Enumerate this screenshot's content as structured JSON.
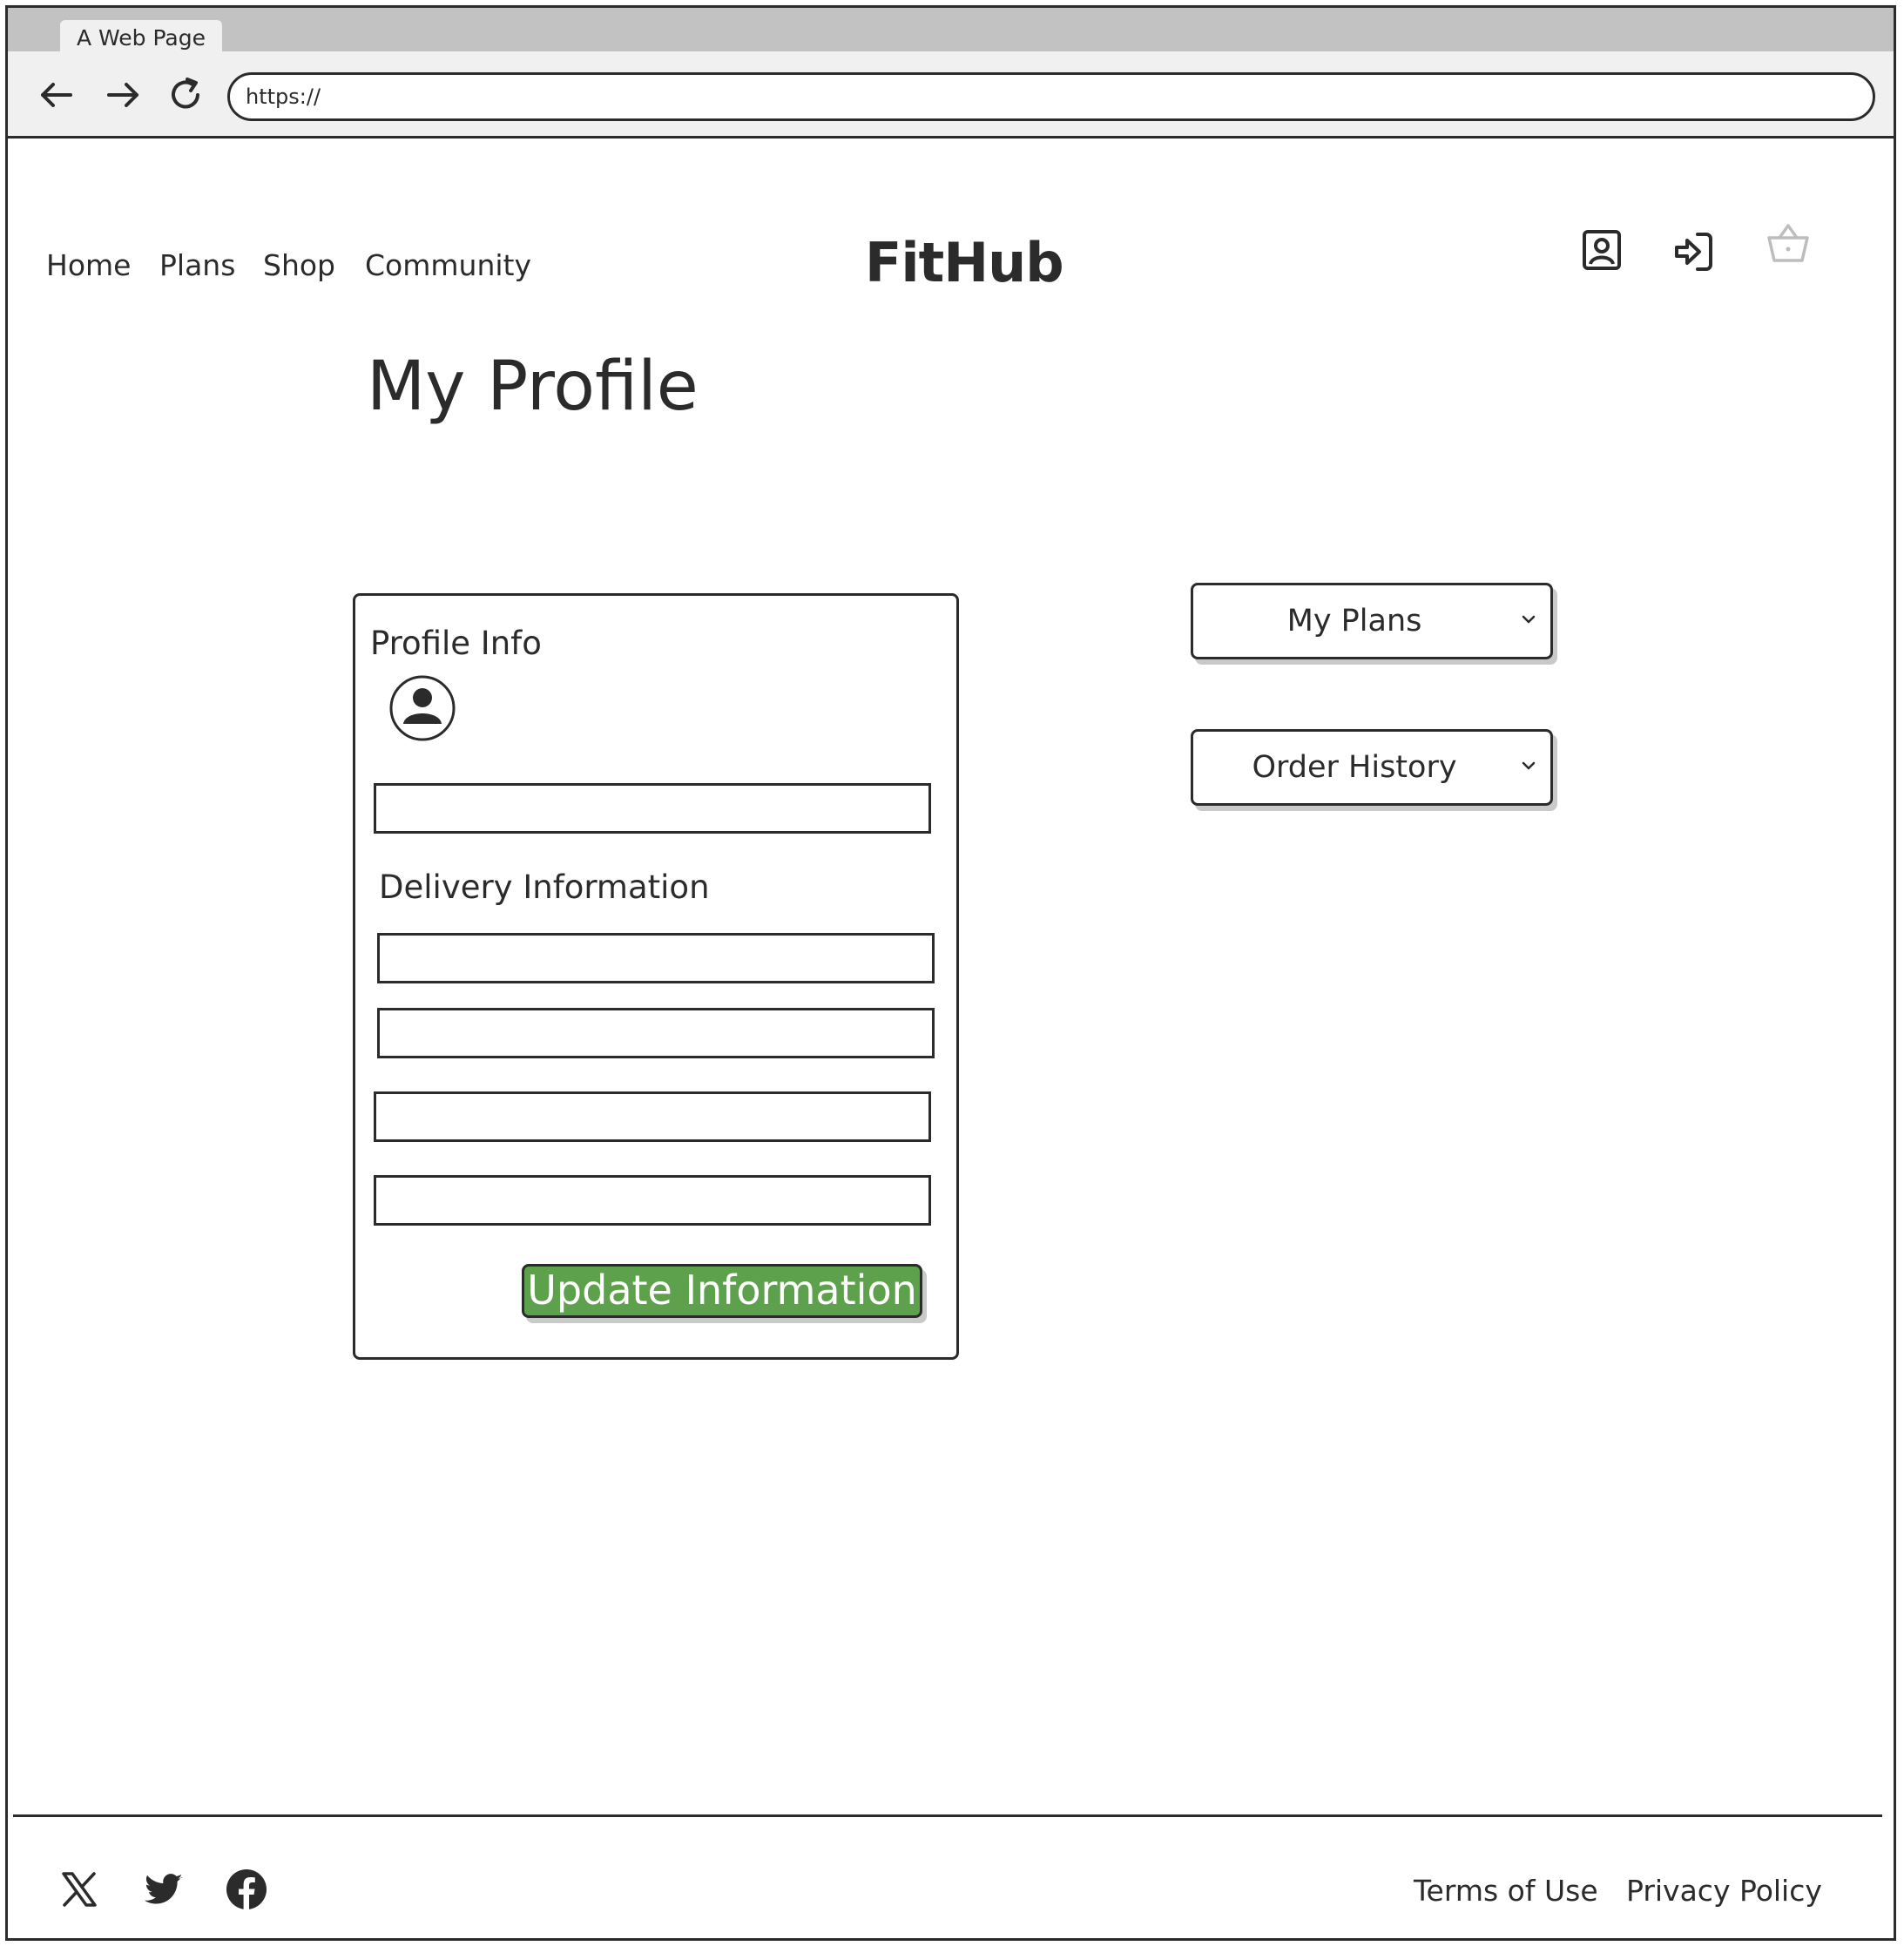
{
  "browser": {
    "tab_title": "A Web Page",
    "url": "https://"
  },
  "nav": {
    "items": [
      {
        "label": "Home"
      },
      {
        "label": "Plans"
      },
      {
        "label": "Shop"
      },
      {
        "label": "Community"
      }
    ],
    "logo": "FitHub"
  },
  "page": {
    "title": "My Profile"
  },
  "profile_card": {
    "profile_heading": "Profile Info",
    "delivery_heading": "Delivery Information",
    "update_button": "Update Information"
  },
  "dropdowns": [
    {
      "label": "My Plans"
    },
    {
      "label": "Order History"
    }
  ],
  "footer": {
    "terms": "Terms of Use",
    "privacy": "Privacy Policy"
  },
  "colors": {
    "accent": "#5ea14c",
    "ink": "#2b2b2b",
    "disabled_icon": "#bdbdbd"
  },
  "icons": {
    "header": [
      "user-profile-icon",
      "login-icon",
      "basket-icon"
    ],
    "social": [
      "x-icon",
      "twitter-icon",
      "facebook-icon"
    ]
  }
}
